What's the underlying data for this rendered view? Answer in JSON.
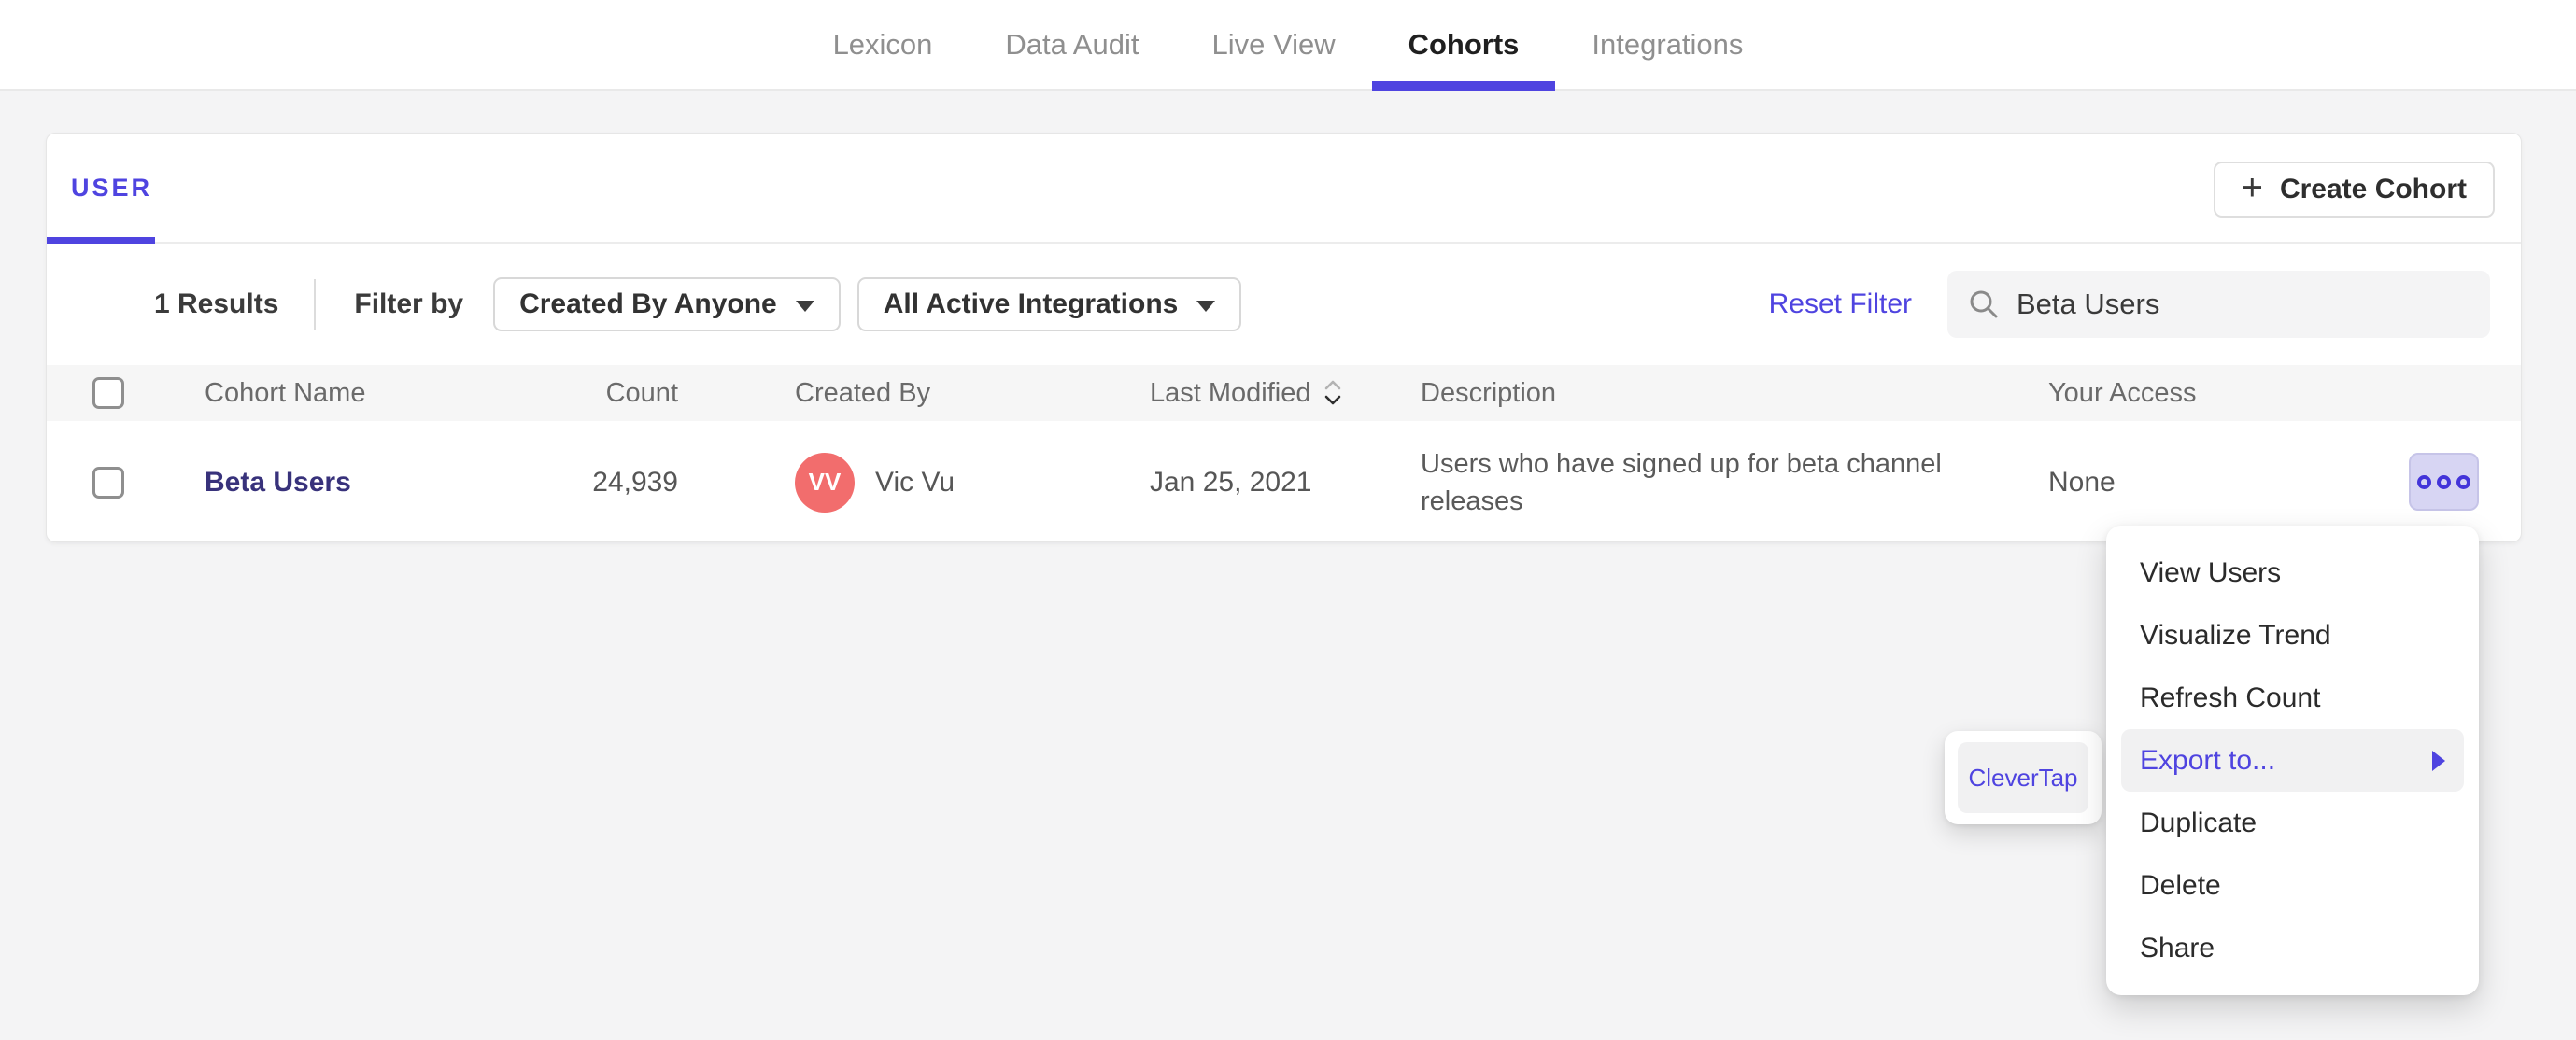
{
  "nav": {
    "items": [
      {
        "label": "Lexicon",
        "active": false
      },
      {
        "label": "Data Audit",
        "active": false
      },
      {
        "label": "Live View",
        "active": false
      },
      {
        "label": "Cohorts",
        "active": true
      },
      {
        "label": "Integrations",
        "active": false
      }
    ]
  },
  "panel": {
    "tab_label": "USER",
    "create_cohort_label": "Create Cohort",
    "plus_icon": "+",
    "toolbar": {
      "results_count": "1 Results",
      "filter_by_label": "Filter by",
      "created_by_filter": "Created By Anyone",
      "integrations_filter": "All Active Integrations",
      "reset_filter_label": "Reset Filter",
      "search_value": "Beta Users"
    },
    "table": {
      "headers": {
        "cohort_name": "Cohort Name",
        "count": "Count",
        "created_by": "Created By",
        "last_modified": "Last Modified",
        "description": "Description",
        "your_access": "Your Access"
      },
      "rows": [
        {
          "name": "Beta Users",
          "count": "24,939",
          "avatar_initials": "VV",
          "created_by": "Vic Vu",
          "last_modified": "Jan 25, 2021",
          "description": "Users who have signed up for beta channel releases",
          "your_access": "None"
        }
      ]
    }
  },
  "context_menu": {
    "items": [
      {
        "label": "View Users",
        "highlighted": false
      },
      {
        "label": "Visualize Trend",
        "highlighted": false
      },
      {
        "label": "Refresh Count",
        "highlighted": false
      },
      {
        "label": "Export to...",
        "highlighted": true,
        "has_submenu": true
      },
      {
        "label": "Duplicate",
        "highlighted": false
      },
      {
        "label": "Delete",
        "highlighted": false
      },
      {
        "label": "Share",
        "highlighted": false
      }
    ]
  },
  "export_submenu": {
    "items": [
      {
        "label": "CleverTap"
      }
    ]
  },
  "colors": {
    "accent": "#4f44e0",
    "avatar": "#f26d6d",
    "cohort_link": "#38327b",
    "highlight_bg": "#f1f1f2",
    "page_bg": "#f4f4f5"
  }
}
